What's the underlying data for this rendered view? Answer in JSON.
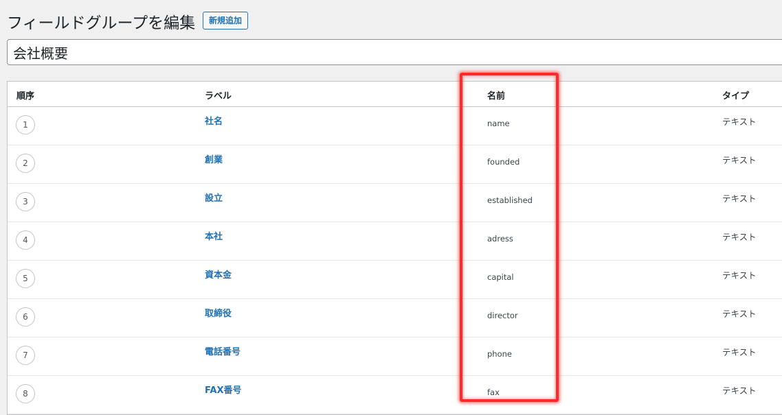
{
  "header": {
    "title": "フィールドグループを編集",
    "add_new_label": "新規追加"
  },
  "group_title": {
    "value": "会社概要"
  },
  "table": {
    "columns": [
      "順序",
      "ラベル",
      "名前",
      "タイプ"
    ],
    "rows": [
      {
        "order": "1",
        "label": "社名",
        "name": "name",
        "type": "テキスト"
      },
      {
        "order": "2",
        "label": "創業",
        "name": "founded",
        "type": "テキスト"
      },
      {
        "order": "3",
        "label": "設立",
        "name": "established",
        "type": "テキスト"
      },
      {
        "order": "4",
        "label": "本社",
        "name": "adress",
        "type": "テキスト"
      },
      {
        "order": "5",
        "label": "資本金",
        "name": "capital",
        "type": "テキスト"
      },
      {
        "order": "6",
        "label": "取締役",
        "name": "director",
        "type": "テキスト"
      },
      {
        "order": "7",
        "label": "電話番号",
        "name": "phone",
        "type": "テキスト"
      },
      {
        "order": "8",
        "label": "FAX番号",
        "name": "fax",
        "type": "テキスト"
      }
    ]
  },
  "highlight": {
    "color": "#ff2a2a",
    "target_column": "名前"
  }
}
